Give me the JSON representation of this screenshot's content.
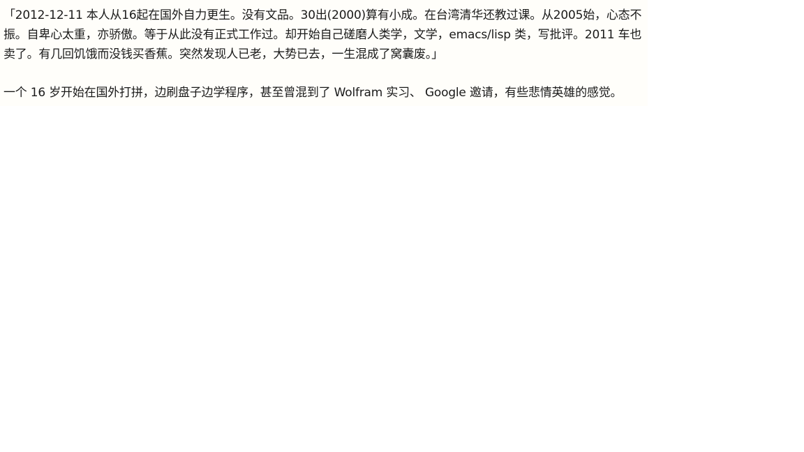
{
  "document": {
    "quote_paragraph": "「2012-12-11 本人从16起在国外自力更生。没有文品。30出(2000)算有小成。在台湾清华还教过课。从2005始，心态不振。自卑心太重，亦骄傲。等于从此没有正式工作过。却开始自己磋磨人类学，文学，emacs/lisp 类，写批评。2011 车也卖了。有几回饥饿而没钱买香蕉。突然发现人已老，大势已去，一生混成了窝囊废。」",
    "comment_paragraph": "一个 16 岁开始在国外打拼，边刷盘子边学程序，甚至曾混到了 Wolfram 实习、 Google 邀请，有些悲情英雄的感觉。"
  }
}
